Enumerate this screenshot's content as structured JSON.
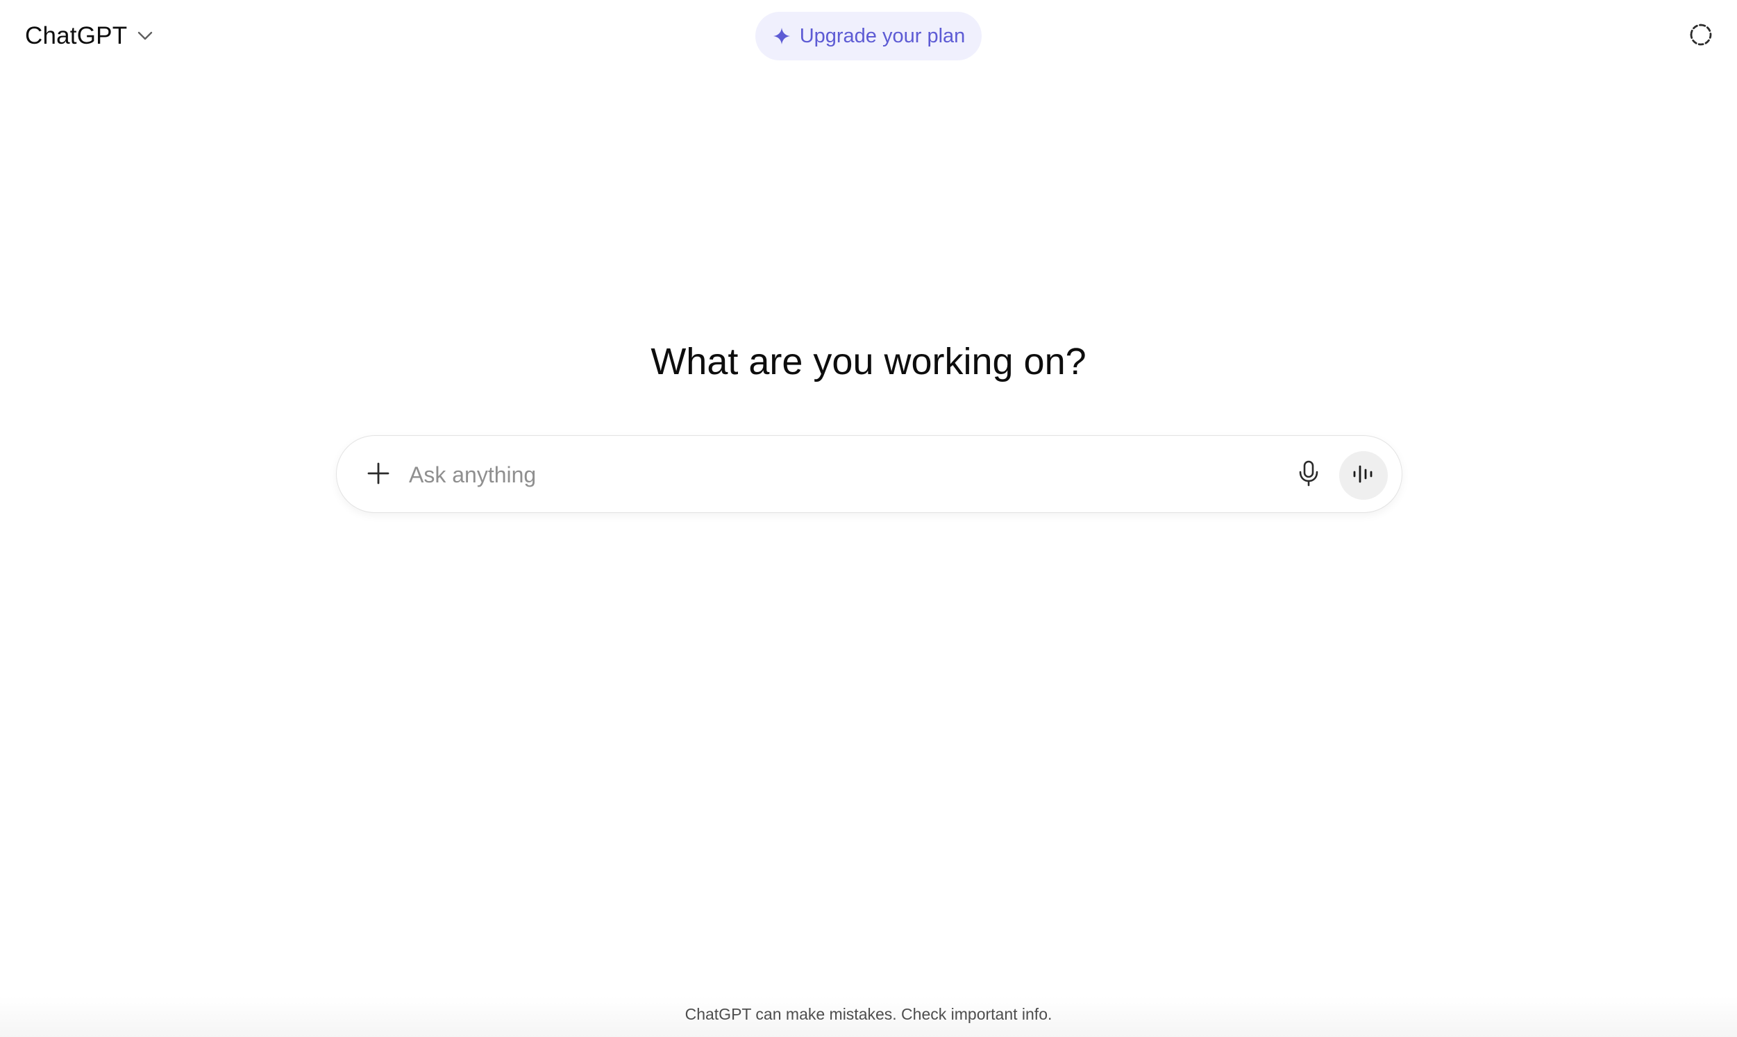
{
  "header": {
    "model_label": "ChatGPT",
    "upgrade_label": "Upgrade your plan"
  },
  "main": {
    "headline": "What are you working on?"
  },
  "composer": {
    "placeholder": "Ask anything",
    "value": ""
  },
  "footer": {
    "disclaimer": "ChatGPT can make mistakes. Check important info."
  },
  "icons": {
    "model_dropdown": "chevron-down-icon",
    "upgrade": "sparkle-icon",
    "temporary_chat": "temporary-chat-icon",
    "attach": "plus-icon",
    "dictate": "microphone-icon",
    "voice_mode": "voice-waveform-icon"
  },
  "colors": {
    "upgrade_accent": "#5d5bd4",
    "upgrade_background": "#f0f0fd",
    "voice_button_background": "#efefef"
  }
}
